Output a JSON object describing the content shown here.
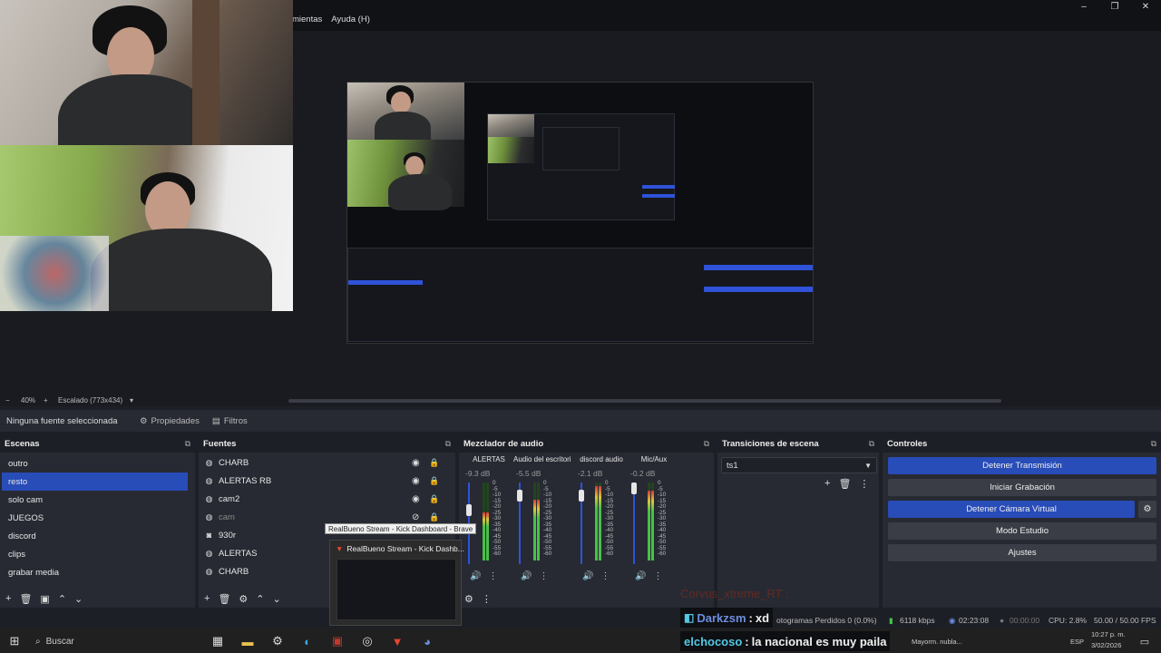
{
  "menu": {
    "items": [
      "mientas",
      "Ayuda (H)"
    ]
  },
  "window_controls": [
    "–",
    "❐",
    "✕"
  ],
  "preview": {
    "zoom": "40%",
    "scaling": "Escalado (773x434)"
  },
  "context": {
    "no_source": "Ninguna fuente seleccionada",
    "properties": "Propiedades",
    "filters": "Filtros"
  },
  "scenes": {
    "title": "Escenas",
    "items": [
      {
        "label": "outro"
      },
      {
        "label": "resto",
        "selected": true
      },
      {
        "label": "solo cam"
      },
      {
        "label": "JUEGOS"
      },
      {
        "label": "discord"
      },
      {
        "label": "clips"
      },
      {
        "label": "grabar media"
      }
    ]
  },
  "sources": {
    "title": "Fuentes",
    "items": [
      {
        "label": "CHARB",
        "icon": "globe-icon"
      },
      {
        "label": "ALERTAS RB",
        "icon": "globe-icon"
      },
      {
        "label": "cam2",
        "icon": "globe-icon"
      },
      {
        "label": "cam",
        "icon": "globe-icon",
        "hidden": true
      },
      {
        "label": "930r",
        "icon": "camera-icon"
      },
      {
        "label": "ALERTAS",
        "icon": "globe-icon"
      },
      {
        "label": "CHARB",
        "icon": "globe-icon"
      }
    ]
  },
  "mixer": {
    "title": "Mezclador de audio",
    "scale": [
      "0",
      "-5",
      "-10",
      "-15",
      "-20",
      "-25",
      "-30",
      "-35",
      "-40",
      "-45",
      "-50",
      "-55",
      "-60"
    ],
    "channels": [
      {
        "name": "ALERTAS",
        "db": "-9.3 dB",
        "level": 0.62,
        "fader": 0.3
      },
      {
        "name": "Audio del escritorio",
        "db": "-5.5 dB",
        "level": 0.78,
        "fader": 0.1
      },
      {
        "name": "discord audio",
        "db": "-2.1 dB",
        "level": 0.95,
        "fader": 0.1
      },
      {
        "name": "Mic/Aux",
        "db": "-0.2 dB",
        "level": 0.9,
        "fader": 0.0
      }
    ]
  },
  "transitions": {
    "title": "Transiciones de escena",
    "selected": "ts1"
  },
  "controls": {
    "title": "Controles",
    "stop_stream": "Detener Transmisión",
    "start_recording": "Iniciar Grabación",
    "stop_virtual_cam": "Detener Cámara Virtual",
    "studio_mode": "Modo Estudio",
    "settings": "Ajustes"
  },
  "status": {
    "dropped": "otogramas Perdidos 0 (0.0%)",
    "bitrate": "6118 kbps",
    "stream_time": "02:23:08",
    "rec_time": "00:00:00",
    "cpu": "CPU: 2.8%",
    "fps": "50.00 / 50.00 FPS"
  },
  "taskbar": {
    "search": "Buscar",
    "weather": "Mayorm. nubla...",
    "lang": "ESP",
    "time": "10:27 p. m.",
    "date": "3/02/2026"
  },
  "tooltip": "RealBueno Stream - Kick Dashboard - Brave",
  "thumb_title": "RealBueno Stream - Kick Dashb...",
  "chat": {
    "ghost": "Corvus_xtreme_RT :",
    "lines": [
      {
        "user": "Darkzsm",
        "text": "xd"
      },
      {
        "user": "elchocoso",
        "text": "la nacional es muy paila"
      }
    ]
  },
  "colors": {
    "accent": "#284cb8",
    "dock_bg": "#272a33",
    "title_bg": "#111216"
  }
}
